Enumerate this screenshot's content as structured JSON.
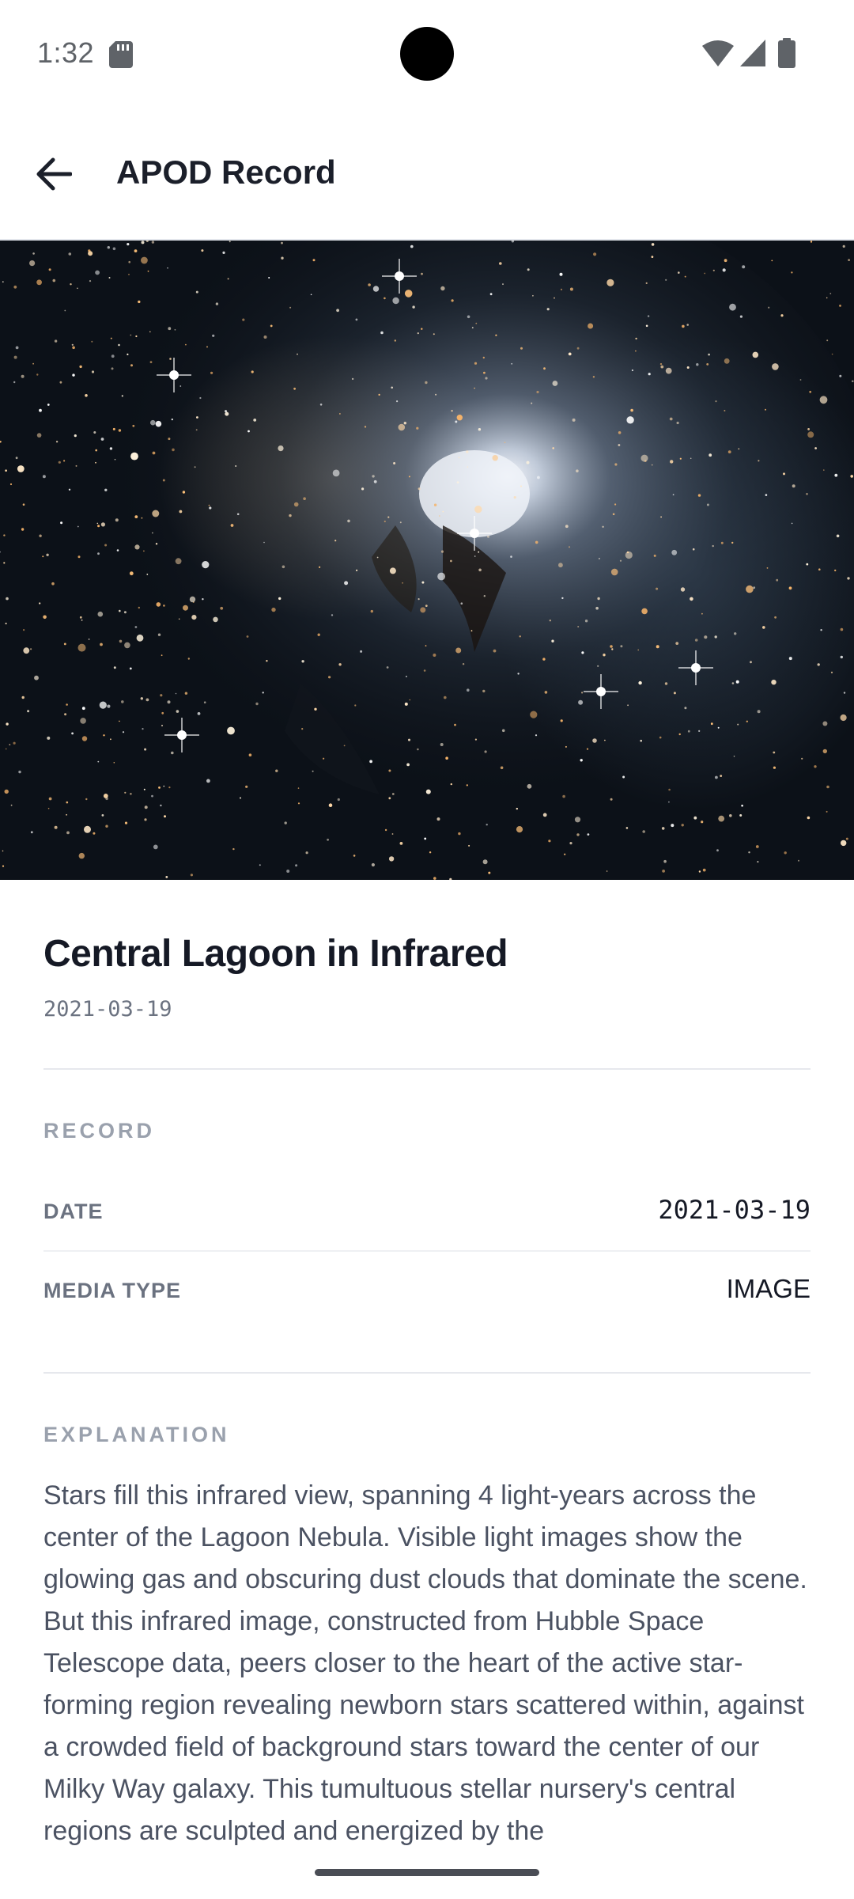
{
  "status_bar": {
    "time": "1:32",
    "icons": [
      "sd-card-icon",
      "wifi-icon",
      "signal-icon",
      "battery-icon"
    ]
  },
  "app_bar": {
    "title": "APOD Record",
    "back_icon": "arrow-left-icon"
  },
  "record": {
    "title": "Central Lagoon in Infrared",
    "date_subtitle": "2021-03-19"
  },
  "record_section": {
    "heading": "RECORD",
    "rows": [
      {
        "label": "DATE",
        "value": "2021-03-19"
      },
      {
        "label": "MEDIA TYPE",
        "value": "IMAGE"
      }
    ]
  },
  "explanation_section": {
    "heading": "EXPLANATION",
    "text": "Stars fill this infrared view, spanning 4 light-years across the center of the Lagoon Nebula. Visible light images show the glowing gas and obscuring dust clouds that dominate the scene. But this infrared image, constructed from Hubble Space Telescope data, peers closer to the heart of the active star-forming region revealing newborn stars scattered within, against a crowded field of background stars toward the center of our Milky Way galaxy. This tumultuous stellar nursery's central regions are sculpted and energized by the"
  },
  "colors": {
    "title": "#151925",
    "muted": "#6b7280",
    "section_label": "#9aa1ad",
    "divider": "#e6e8ed",
    "body_text": "#4b5262"
  }
}
